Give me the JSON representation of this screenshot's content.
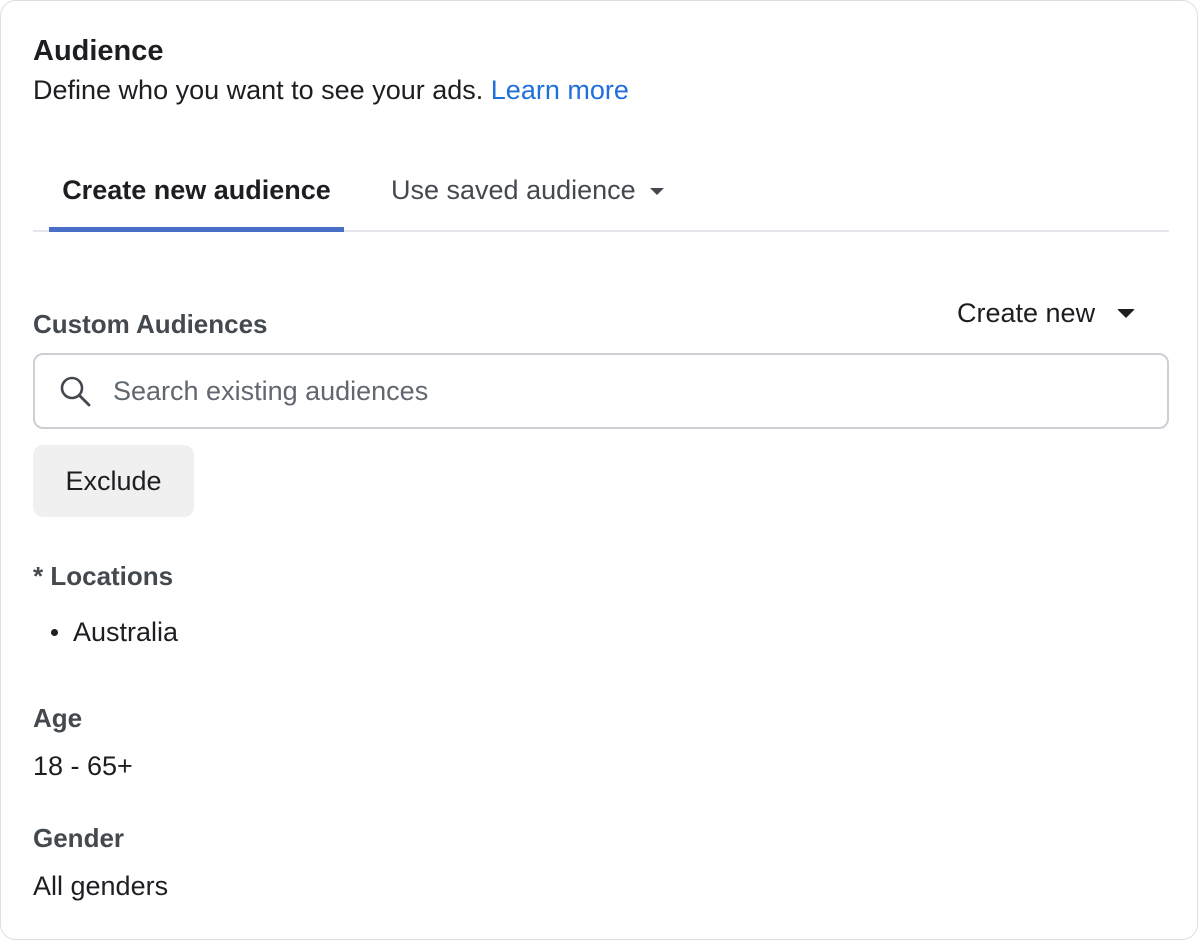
{
  "audience": {
    "title": "Audience",
    "description": "Define who you want to see your ads.",
    "learn_more": "Learn more"
  },
  "tabs": [
    {
      "label": "Create new audience",
      "active": true
    },
    {
      "label": "Use saved audience",
      "active": false
    }
  ],
  "custom_audiences": {
    "label": "Custom Audiences",
    "create_new_label": "Create new",
    "search_placeholder": "Search existing audiences",
    "search_value": "",
    "exclude_label": "Exclude"
  },
  "locations": {
    "label": "* Locations",
    "items": [
      "Australia"
    ]
  },
  "age": {
    "label": "Age",
    "value": "18 - 65+"
  },
  "gender": {
    "label": "Gender",
    "value": "All genders"
  },
  "colors": {
    "link": "#216fdb",
    "tab_indicator": "#4a6fc8",
    "button_bg": "#f0f0f0"
  },
  "icons": {
    "search": "search-icon",
    "dropdown": "caret-down-icon"
  }
}
